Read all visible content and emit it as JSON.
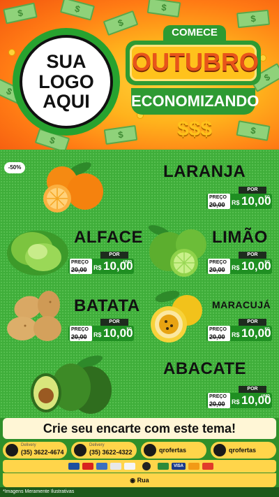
{
  "header": {
    "logo_lines": [
      "SUA",
      "LOGO",
      "AQUI"
    ],
    "promo_top": "COMECE",
    "promo_main": "OUTUBRO",
    "promo_bottom": "ECONOMIZANDO",
    "promo_symbols": "$$$"
  },
  "discount_badge": "-50%",
  "price_tag": {
    "preco": "PREÇO",
    "por": "POR",
    "currency": "R$"
  },
  "products": [
    {
      "name": "LARANJA",
      "old_price": "20,00",
      "price": "10,00",
      "unit": "KG"
    },
    {
      "name": "ALFACE",
      "old_price": "20,00",
      "price": "10,00",
      "unit": "UNID"
    },
    {
      "name": "LIMÃO",
      "old_price": "20,00",
      "price": "10,00",
      "unit": "KG"
    },
    {
      "name": "BATATA",
      "old_price": "20,00",
      "price": "10,00",
      "unit": "KG"
    },
    {
      "name": "MARACUJÁ",
      "old_price": "20,00",
      "price": "10,00",
      "unit": "KG"
    },
    {
      "name": "ABACATE",
      "old_price": "20,00",
      "price": "10,00",
      "unit": "UNID"
    }
  ],
  "cta": "Crie seu encarte com este tema!",
  "contacts": [
    {
      "label": "Delivery",
      "value": "(35) 3622-4674",
      "icon": "whatsapp-icon"
    },
    {
      "label": "Delivery",
      "value": "(35) 3622-4322",
      "icon": "phone-icon"
    },
    {
      "label": "",
      "value": "qrofertas",
      "icon": "facebook-icon"
    },
    {
      "label": "",
      "value": "qrofertas",
      "icon": "instagram-icon"
    }
  ],
  "payment_labels": [
    "VISA"
  ],
  "address": "Rua",
  "disclaimer": "*Imagens Meramente Ilustrativas",
  "colors": {
    "green": "#3fae3a",
    "orange": "#ff7a14",
    "yellow": "#ffd54a",
    "tag_green": "#1f8f22"
  }
}
